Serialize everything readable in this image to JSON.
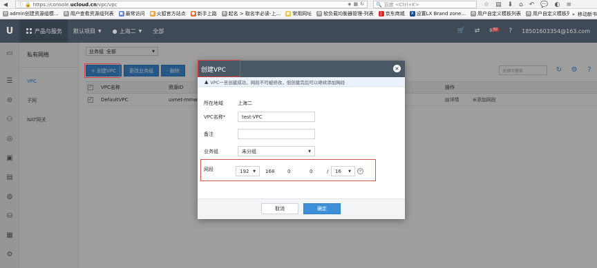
{
  "browser": {
    "url_prefix": "https://console.",
    "url_domain": "ucloud.cn",
    "url_path": "/vpc/vpc",
    "search_placeholder": "百度 <Ctrl+K>",
    "bookmarks": [
      "admin创建资源组模...",
      "用户查看资源组列表",
      "最常访问",
      "火狐官方站点",
      "新手上路",
      "起名 > 取名字必读-上...",
      "常用网址",
      "软负载均衡器管理-列表",
      "京东商城",
      "设置LX Brand zone...",
      "用户自定义模板列表",
      "用户自定义模板列表"
    ],
    "bookmarks_more": "移动新书"
  },
  "topbar": {
    "logo": "U",
    "products": "产品与服务",
    "project": "默认项目",
    "region": "上海二",
    "zone": "全部",
    "mail_badge": "82",
    "email": "18501603354@163.com"
  },
  "sidebar": {
    "title": "私有网络",
    "items": [
      "VPC",
      "子网",
      "NAT网关"
    ]
  },
  "main": {
    "filter_label": "业务组",
    "filter_value": "全部",
    "buttons": {
      "create": "+ 创建VPC",
      "change_group": "更改业务组",
      "delete": "- 删除"
    },
    "search_placeholder": "关键字搜索",
    "table": {
      "headers": [
        "VPC名称",
        "资源ID",
        "操作"
      ],
      "rows": [
        {
          "name": "DefaultVPC",
          "id": "uvnet-mmw",
          "op_detail": "详情",
          "op_add": "添加网段"
        }
      ]
    }
  },
  "modal": {
    "title": "创建VPC",
    "notice": "VPC一旦创建成功，网段不可被修改，但创建完后可以继续添加网段",
    "region_label": "所在地域",
    "region_value": "上海二",
    "name_label": "VPC名称*",
    "name_value": "test-VPC",
    "remark_label": "备注",
    "remark_value": "",
    "group_label": "业务组",
    "group_value": "未分组",
    "segment_label": "网段",
    "ip": {
      "o1": "192",
      "o2": "168",
      "o3": "0",
      "o4": "0",
      "mask": "16"
    },
    "cancel": "取消",
    "confirm": "确定"
  }
}
